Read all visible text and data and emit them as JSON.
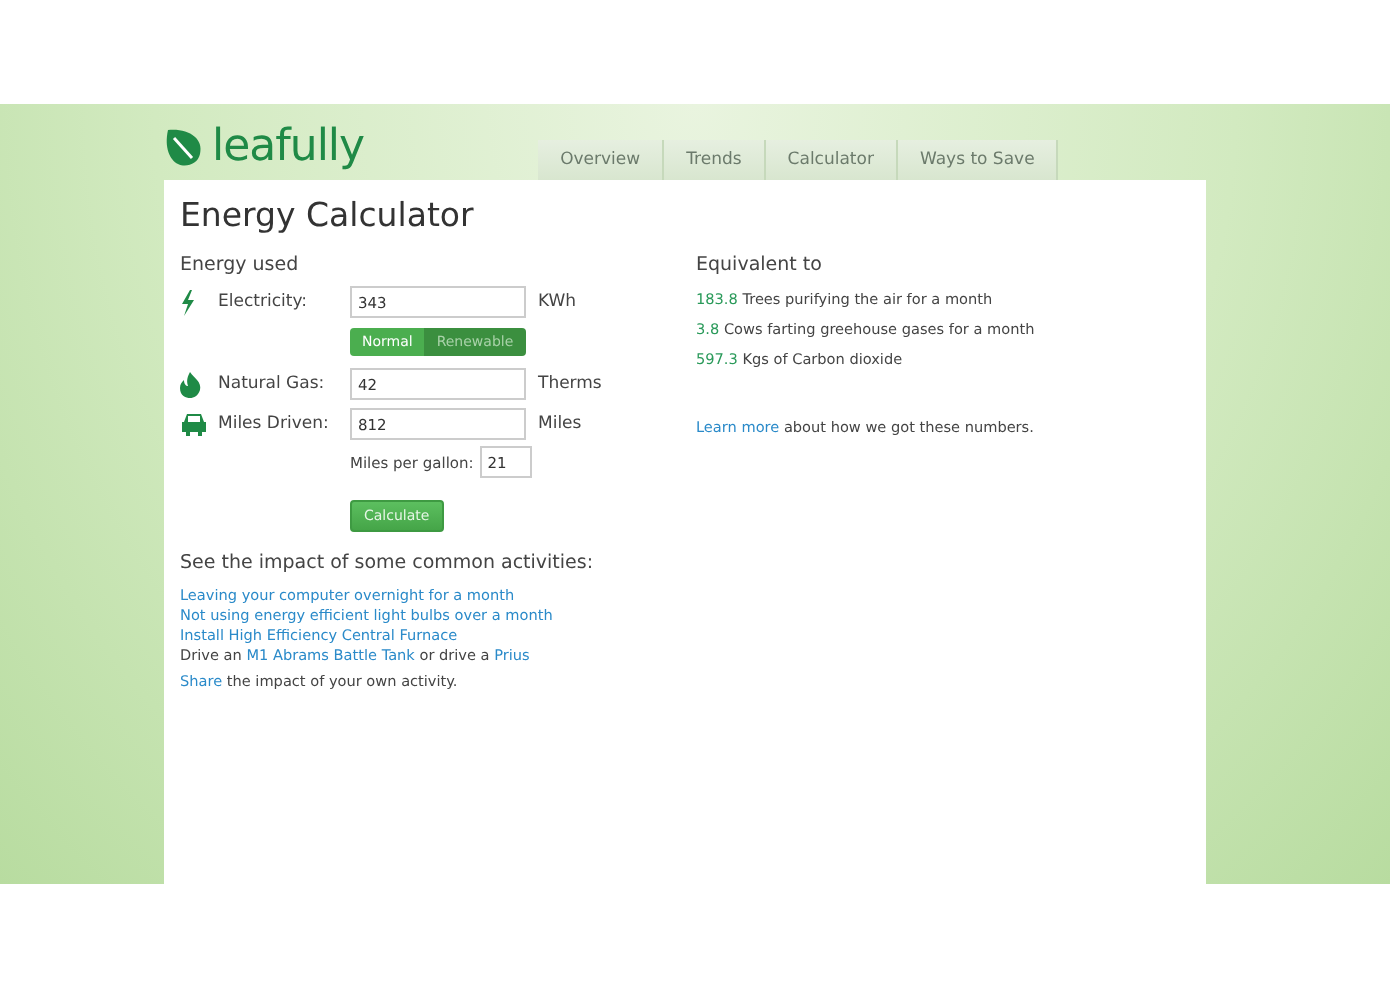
{
  "logo": {
    "name": "leafully"
  },
  "tabs": [
    {
      "label": "Overview",
      "selected": false
    },
    {
      "label": "Trends",
      "selected": false
    },
    {
      "label": "Calculator",
      "selected": false
    },
    {
      "label": "Ways to Save",
      "selected": false
    }
  ],
  "title": "Energy Calculator",
  "energy": {
    "heading": "Energy used",
    "rows": [
      {
        "kind": "electricity",
        "label": "Electricity:",
        "value": "343",
        "unit": "KWh"
      },
      {
        "kind": "gas",
        "label": "Natural Gas:",
        "value": "42",
        "unit": "Therms"
      },
      {
        "kind": "car",
        "label": "Miles Driven:",
        "value": "812",
        "unit": "Miles"
      }
    ],
    "toggle": [
      {
        "label": "Normal",
        "selected": true
      },
      {
        "label": "Renewable",
        "selected": false
      }
    ],
    "mpg": {
      "label": "Miles per gallon:",
      "value": "21"
    },
    "button": "Calculate"
  },
  "equivalent": {
    "heading": "Equivalent to",
    "items": [
      {
        "value": "183.8",
        "text": "Trees purifying the air for a month"
      },
      {
        "value": "3.8",
        "text": "Cows farting greehouse gases for a month"
      },
      {
        "value": "597.3",
        "text": "Kgs of Carbon dioxide"
      }
    ],
    "note": [
      {
        "text": "Learn more",
        "link": true
      },
      {
        "text": " about how we got these numbers.",
        "link": false
      }
    ]
  },
  "activities": {
    "heading": "See the impact of some common activities:",
    "lines": [
      [
        {
          "text": "Leaving your computer overnight for a month",
          "link": true
        }
      ],
      [
        {
          "text": "Not using energy efficient light bulbs over a month",
          "link": true
        }
      ],
      [
        {
          "text": "Install High Efficiency Central Furnace",
          "link": true
        }
      ],
      [
        {
          "text": "Drive an ",
          "link": false
        },
        {
          "text": "M1 Abrams Battle Tank",
          "link": true
        },
        {
          "text": " or drive a ",
          "link": false
        },
        {
          "text": "Prius",
          "link": true
        }
      ]
    ],
    "share": [
      {
        "text": "Share",
        "link": true
      },
      {
        "text": " the impact of your own activity.",
        "link": false
      }
    ]
  }
}
